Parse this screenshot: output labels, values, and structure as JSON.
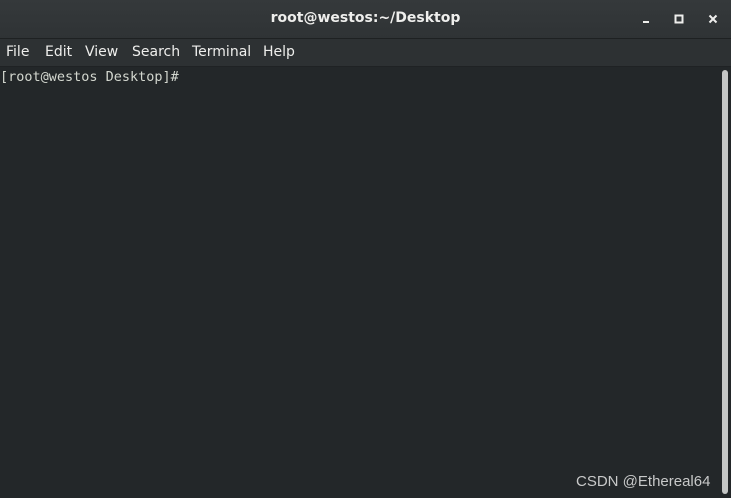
{
  "window": {
    "title": "root@westos:~/Desktop",
    "buttons": {
      "minimize_icon": "minimize-icon",
      "maximize_icon": "maximize-icon",
      "close_icon": "close-icon"
    }
  },
  "menubar": {
    "items": [
      "File",
      "Edit",
      "View",
      "Search",
      "Terminal",
      "Help"
    ]
  },
  "terminal": {
    "prompt": "[root@westos Desktop]# "
  },
  "watermark": "CSDN @Ethereal64",
  "colors": {
    "background": "#232729",
    "titlebar": "#2f3335",
    "text": "#eeeeec",
    "terminal_text": "#d3d7cf"
  }
}
